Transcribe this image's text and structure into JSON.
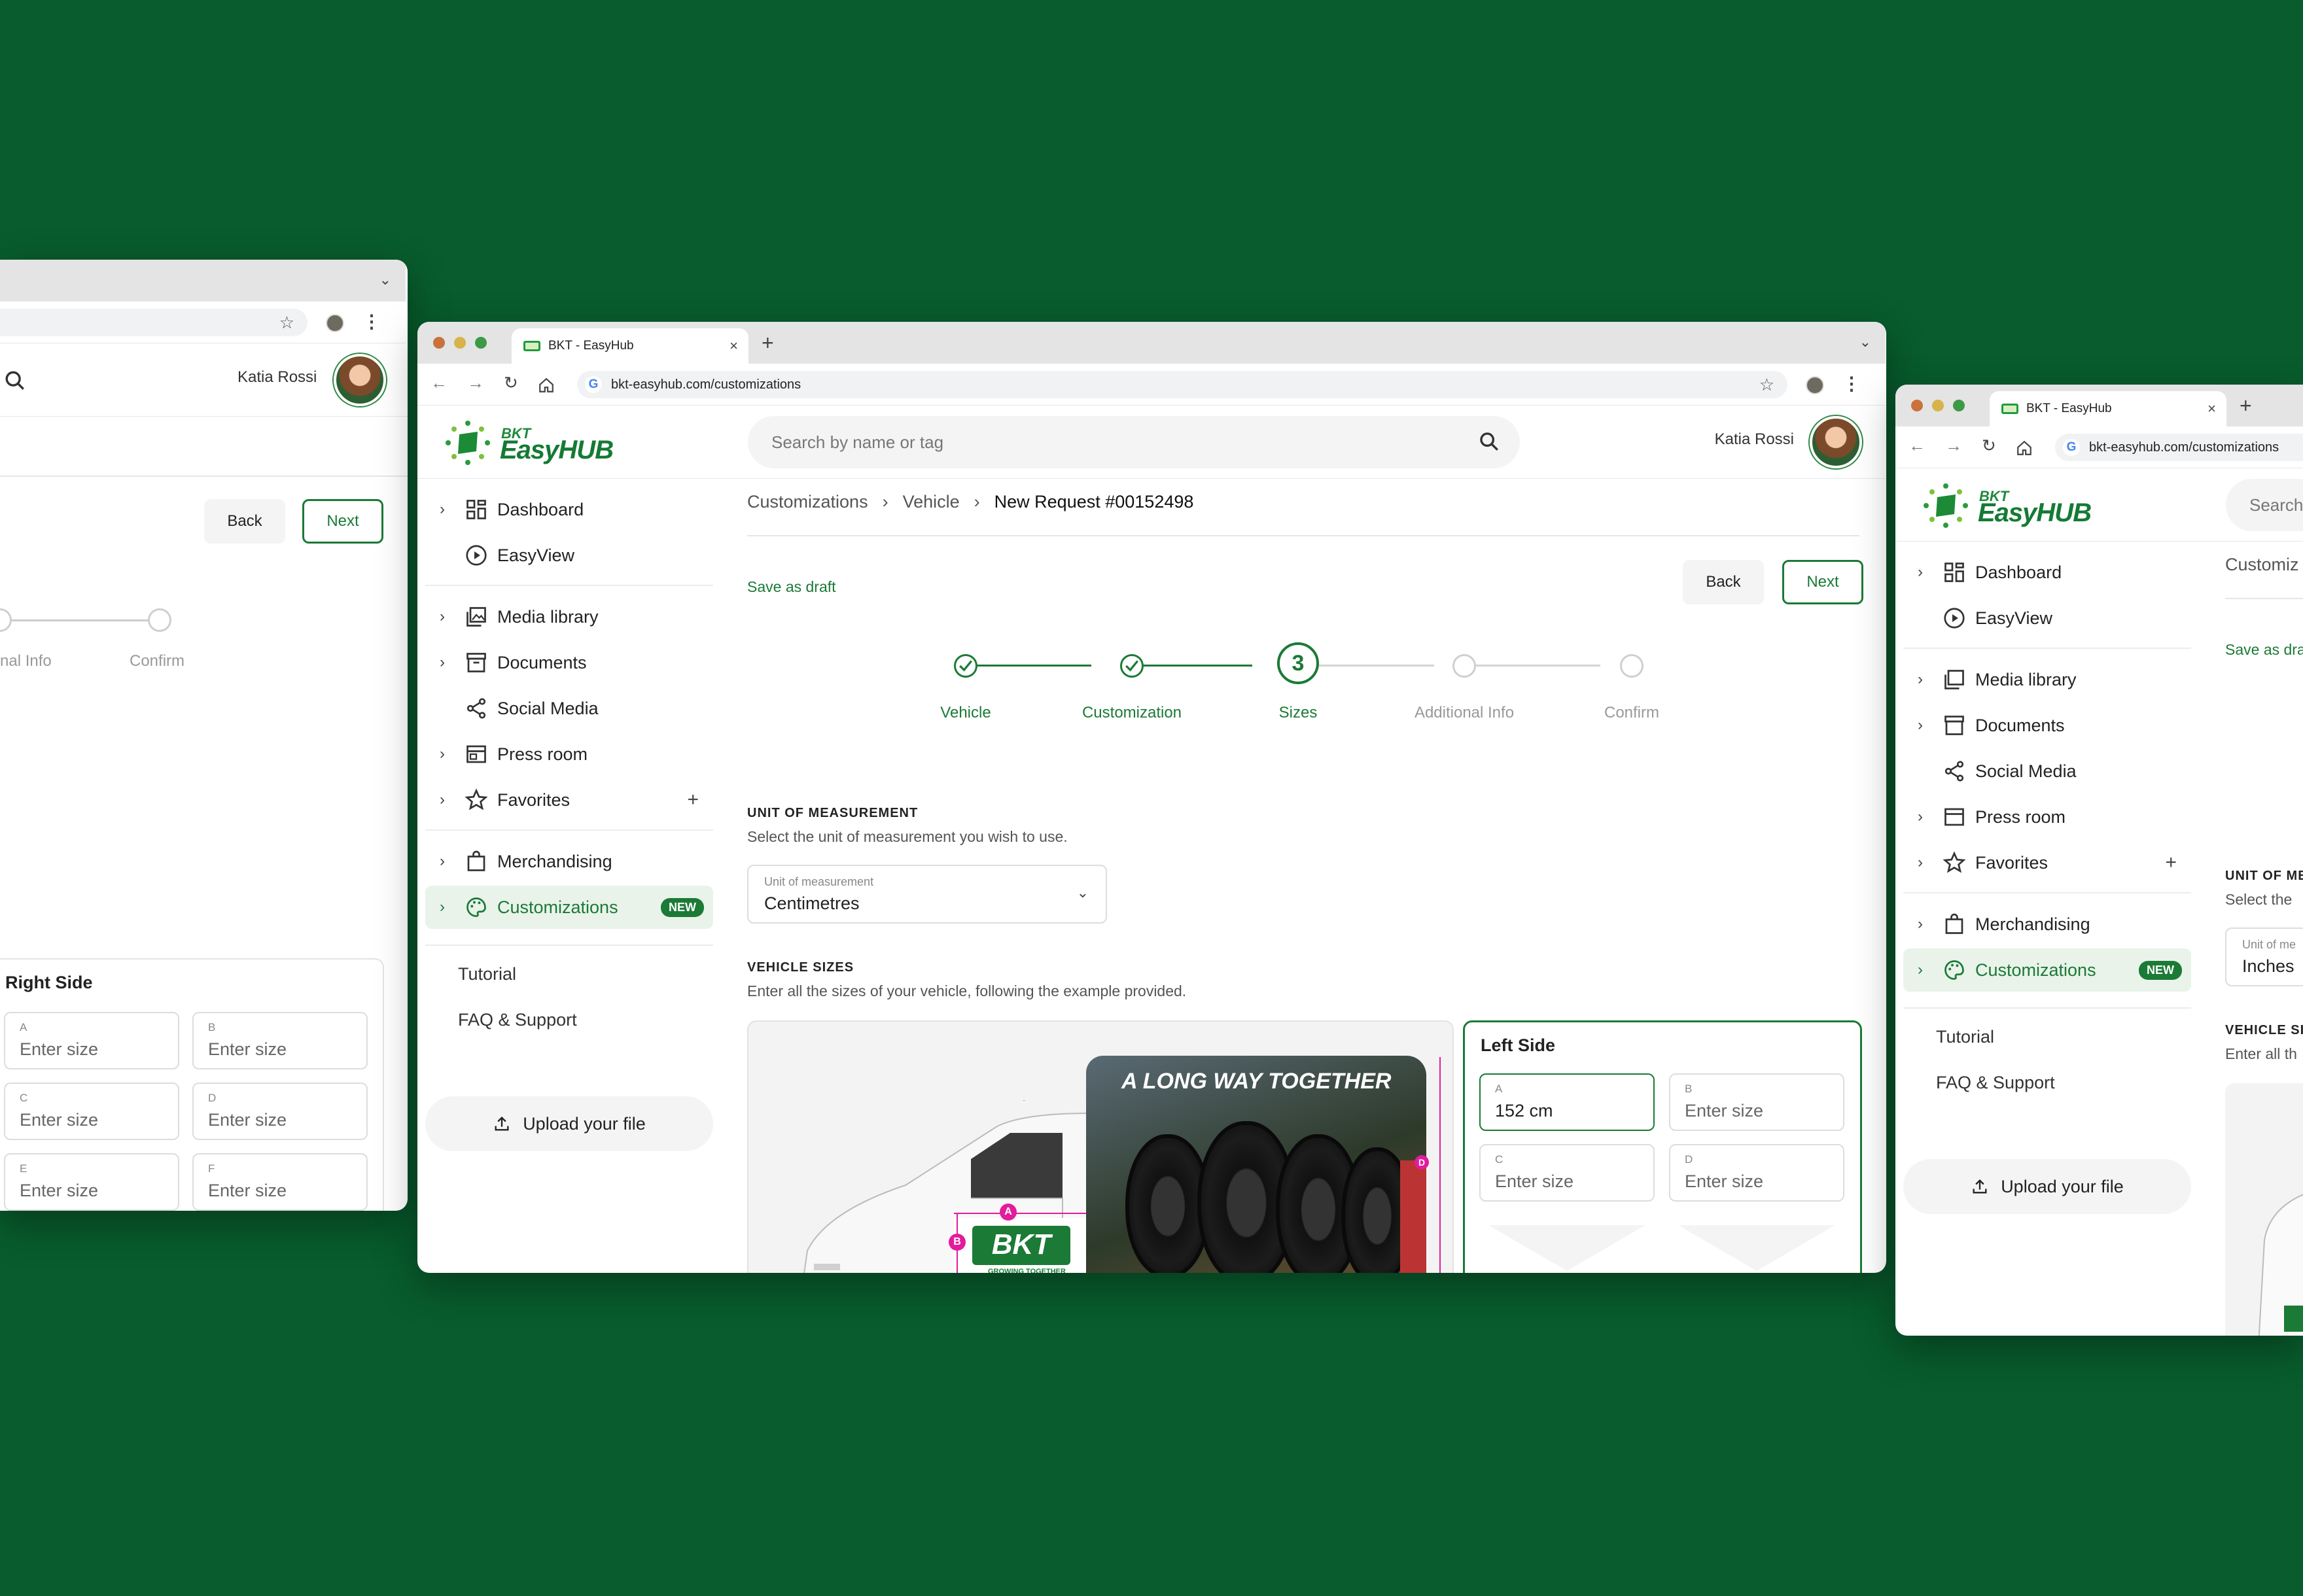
{
  "browser": {
    "tab_title": "BKT - EasyHub",
    "url": "bkt-easyhub.com/customizations",
    "traffic_lights": [
      "#c9723c",
      "#d8b24a",
      "#3c9a46"
    ]
  },
  "header": {
    "logo_small": "BKT",
    "logo_big": "EasyHUB",
    "search_placeholder": "Search by name or tag",
    "user_name": "Katia Rossi"
  },
  "sidebar": {
    "items": [
      {
        "label": "Dashboard",
        "icon": "dashboard-icon",
        "chevron": true
      },
      {
        "label": "EasyView",
        "icon": "play-circle-icon",
        "chevron": false
      },
      {
        "label": "Media library",
        "icon": "media-library-icon",
        "chevron": true
      },
      {
        "label": "Documents",
        "icon": "archive-icon",
        "chevron": true
      },
      {
        "label": "Social Media",
        "icon": "share-icon",
        "chevron": false
      },
      {
        "label": "Press room",
        "icon": "newspaper-icon",
        "chevron": true
      },
      {
        "label": "Favorites",
        "icon": "star-icon",
        "chevron": true
      },
      {
        "label": "Merchandising",
        "icon": "shopping-bag-icon",
        "chevron": true
      },
      {
        "label": "Customizations",
        "icon": "palette-icon",
        "chevron": true
      }
    ],
    "new_badge": "NEW",
    "links": [
      "Tutorial",
      "FAQ & Support"
    ],
    "upload_label": "Upload your file"
  },
  "main": {
    "breadcrumb": [
      "Customizations",
      "Vehicle",
      "New Request #00152498"
    ],
    "save_draft": "Save as draft",
    "back": "Back",
    "next": "Next",
    "steps": [
      "Vehicle",
      "Customization",
      "Sizes",
      "Additional Info",
      "Confirm"
    ],
    "current_step_number": "3",
    "current_step": 3,
    "unit_heading": "UNIT OF MEASUREMENT",
    "unit_sub": "Select the unit of measurement you wish to use.",
    "unit_label": "Unit of measurement",
    "unit_value": "Centimetres",
    "sizes_heading": "VEHICLE SIZES",
    "sizes_sub": "Enter all the sizes of your vehicle, following the example provided.",
    "banner_text": "A LONG WAY TOGETHER",
    "van_logo": "BKT",
    "van_slogan": "GROWING TOGETHER",
    "markers": [
      "A",
      "B",
      "D"
    ],
    "panel_title": "Left Side",
    "fields": [
      {
        "key": "A",
        "value": "152 cm"
      },
      {
        "key": "B",
        "value": "Enter size"
      },
      {
        "key": "C",
        "value": "Enter size"
      },
      {
        "key": "D",
        "value": "Enter size"
      }
    ]
  },
  "left_window": {
    "steps_visible": [
      "nal Info",
      "Confirm"
    ],
    "panel_title": "Right Side",
    "fields": [
      {
        "key": "A",
        "value": "Enter size"
      },
      {
        "key": "B",
        "value": "Enter size"
      },
      {
        "key": "C",
        "value": "Enter size"
      },
      {
        "key": "D",
        "value": "Enter size"
      },
      {
        "key": "E",
        "value": "Enter size"
      },
      {
        "key": "F",
        "value": "Enter size"
      }
    ]
  },
  "right_window": {
    "search_partial": "Search",
    "breadcrumb_partial": "Customiz",
    "draft_partial": "Save as dra",
    "unit_heading_partial": "UNIT OF ME",
    "unit_sub_partial": "Select the",
    "unit_label_partial": "Unit of me",
    "unit_value": "Inches",
    "sizes_heading_partial": "VEHICLE SI",
    "sizes_sub_partial": "Enter all th"
  }
}
